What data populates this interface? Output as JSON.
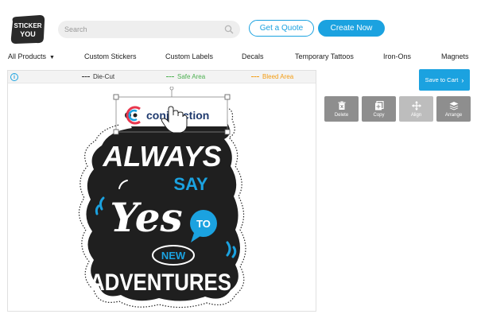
{
  "brand": {
    "logo_line1": "STICKER",
    "logo_line2": "YOU"
  },
  "header": {
    "search_placeholder": "Search",
    "quote_button": "Get a Quote",
    "create_button": "Create Now"
  },
  "nav": {
    "items": [
      "All Products",
      "Custom Stickers",
      "Custom Labels",
      "Decals",
      "Temporary Tattoos",
      "Iron-Ons",
      "Magnets"
    ]
  },
  "canvas": {
    "legend": [
      {
        "label": "Die-Cut",
        "color": "#333333"
      },
      {
        "label": "Safe Area",
        "color": "#4caf50"
      },
      {
        "label": "Bleed Area",
        "color": "#f39c12"
      }
    ]
  },
  "design": {
    "brand_name": "conjunction",
    "line1": "ALWAYS",
    "line2": "SAY",
    "line3": "Yes",
    "bubble": "TO",
    "oval": "NEW",
    "line4": "ADVENTURES"
  },
  "tools": {
    "save_label": "Save to Cart",
    "items": [
      {
        "label": "Delete",
        "icon": "trash-icon",
        "color": "#8e8e8e"
      },
      {
        "label": "Copy",
        "icon": "copy-icon",
        "color": "#8e8e8e"
      },
      {
        "label": "Align",
        "icon": "align-icon",
        "color": "#bdbdbd"
      },
      {
        "label": "Arrange",
        "icon": "layers-icon",
        "color": "#8e8e8e"
      }
    ]
  },
  "colors": {
    "accent": "#1ba2e0",
    "sticker_bg": "#1f1f1f",
    "red": "#e8374e"
  }
}
